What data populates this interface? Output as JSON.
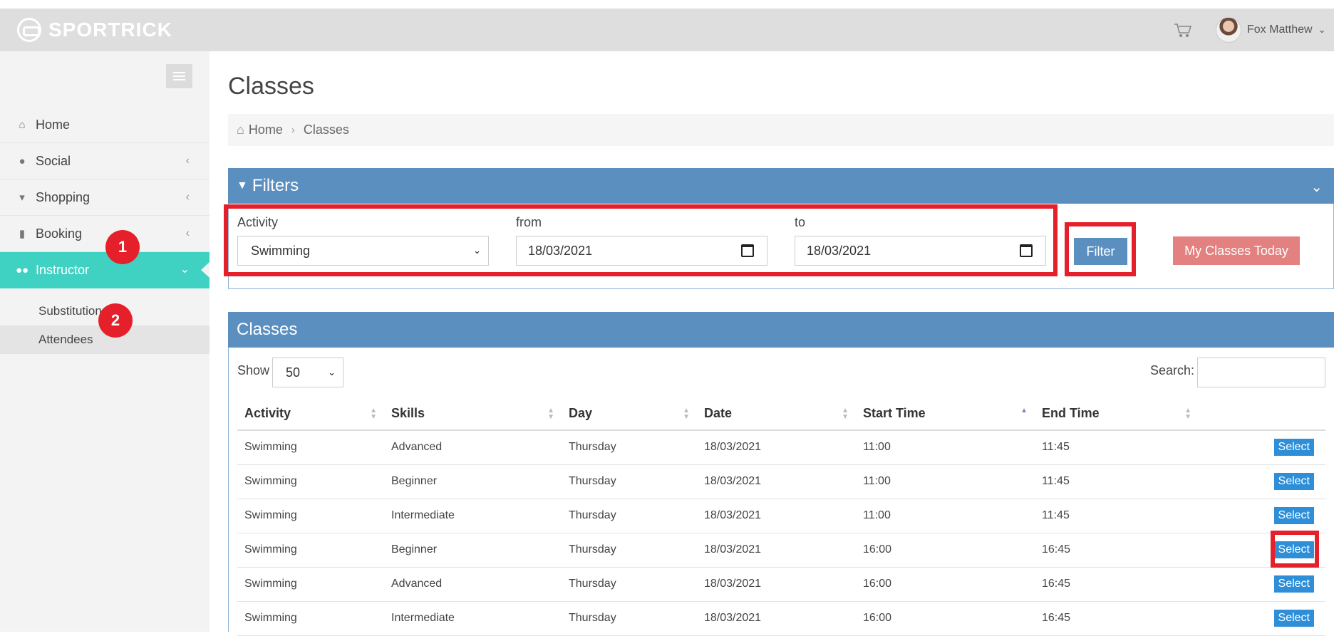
{
  "app": {
    "logo_text": "SPORTRICK"
  },
  "header": {
    "user_name": "Fox Matthew"
  },
  "sidebar": {
    "items": [
      {
        "label": "Home"
      },
      {
        "label": "Social"
      },
      {
        "label": "Shopping"
      },
      {
        "label": "Booking"
      },
      {
        "label": "Instructor"
      }
    ],
    "subitems": [
      {
        "label": "Substitutions"
      },
      {
        "label": "Attendees"
      }
    ]
  },
  "annotations": {
    "badge1": "1",
    "badge2": "2"
  },
  "page": {
    "title": "Classes"
  },
  "breadcrumb": {
    "home": "Home",
    "current": "Classes"
  },
  "filters": {
    "title": "Filters",
    "activity_label": "Activity",
    "activity_value": "Swimming",
    "from_label": "from",
    "from_value": "18/03/2021",
    "to_label": "to",
    "to_value": "18/03/2021",
    "filter_button": "Filter",
    "today_button": "My Classes Today"
  },
  "classes": {
    "title": "Classes",
    "show_label": "Show",
    "show_value": "50",
    "search_label": "Search:",
    "columns": [
      "Activity",
      "Skills",
      "Day",
      "Date",
      "Start Time",
      "End Time"
    ],
    "select_label": "Select",
    "rows": [
      {
        "activity": "Swimming",
        "skills": "Advanced",
        "day": "Thursday",
        "date": "18/03/2021",
        "start": "11:00",
        "end": "11:45"
      },
      {
        "activity": "Swimming",
        "skills": "Beginner",
        "day": "Thursday",
        "date": "18/03/2021",
        "start": "11:00",
        "end": "11:45"
      },
      {
        "activity": "Swimming",
        "skills": "Intermediate",
        "day": "Thursday",
        "date": "18/03/2021",
        "start": "11:00",
        "end": "11:45"
      },
      {
        "activity": "Swimming",
        "skills": "Beginner",
        "day": "Thursday",
        "date": "18/03/2021",
        "start": "16:00",
        "end": "16:45"
      },
      {
        "activity": "Swimming",
        "skills": "Advanced",
        "day": "Thursday",
        "date": "18/03/2021",
        "start": "16:00",
        "end": "16:45"
      },
      {
        "activity": "Swimming",
        "skills": "Intermediate",
        "day": "Thursday",
        "date": "18/03/2021",
        "start": "16:00",
        "end": "16:45"
      }
    ]
  },
  "colors": {
    "accent": "#3fd1c2",
    "panel": "#5a8fc0",
    "highlight": "#e5202a",
    "button_blue": "#2e8fd8",
    "button_pink": "#e38080"
  }
}
